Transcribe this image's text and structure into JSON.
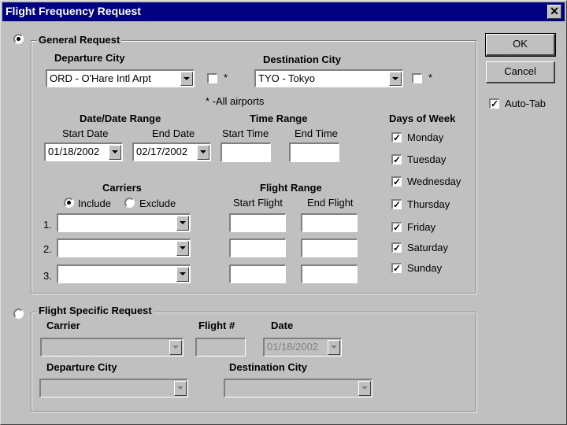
{
  "window": {
    "title": "Flight Frequency Request",
    "close_glyph": "✕"
  },
  "buttons": {
    "ok": "OK",
    "cancel": "Cancel"
  },
  "auto_tab": {
    "label": "Auto-Tab",
    "checked": true
  },
  "general": {
    "legend": "General Request",
    "departure_label": "Departure City",
    "departure_value": "ORD - O'Hare Intl Arpt",
    "destination_label": "Destination City",
    "destination_value": "TYO - Tokyo",
    "star": "*",
    "all_airports": "* -All airports",
    "date_range_label": "Date/Date Range",
    "start_date_label": "Start Date",
    "start_date_value": "01/18/2002",
    "end_date_label": "End Date",
    "end_date_value": "02/17/2002",
    "time_range_label": "Time Range",
    "start_time_label": "Start Time",
    "end_time_label": "End Time",
    "carriers_label": "Carriers",
    "include_label": "Include",
    "exclude_label": "Exclude",
    "flight_range_label": "Flight Range",
    "start_flight_label": "Start Flight",
    "end_flight_label": "End Flight",
    "row_numbers": [
      "1.",
      "2.",
      "3."
    ],
    "days_label": "Days of Week",
    "days": [
      "Monday",
      "Tuesday",
      "Wednesday",
      "Thursday",
      "Friday",
      "Saturday",
      "Sunday"
    ]
  },
  "specific": {
    "legend": "Flight Specific Request",
    "carrier_label": "Carrier",
    "flight_label": "Flight #",
    "date_label": "Date",
    "date_value": "01/18/2002",
    "departure_label": "Departure City",
    "destination_label": "Destination City"
  }
}
